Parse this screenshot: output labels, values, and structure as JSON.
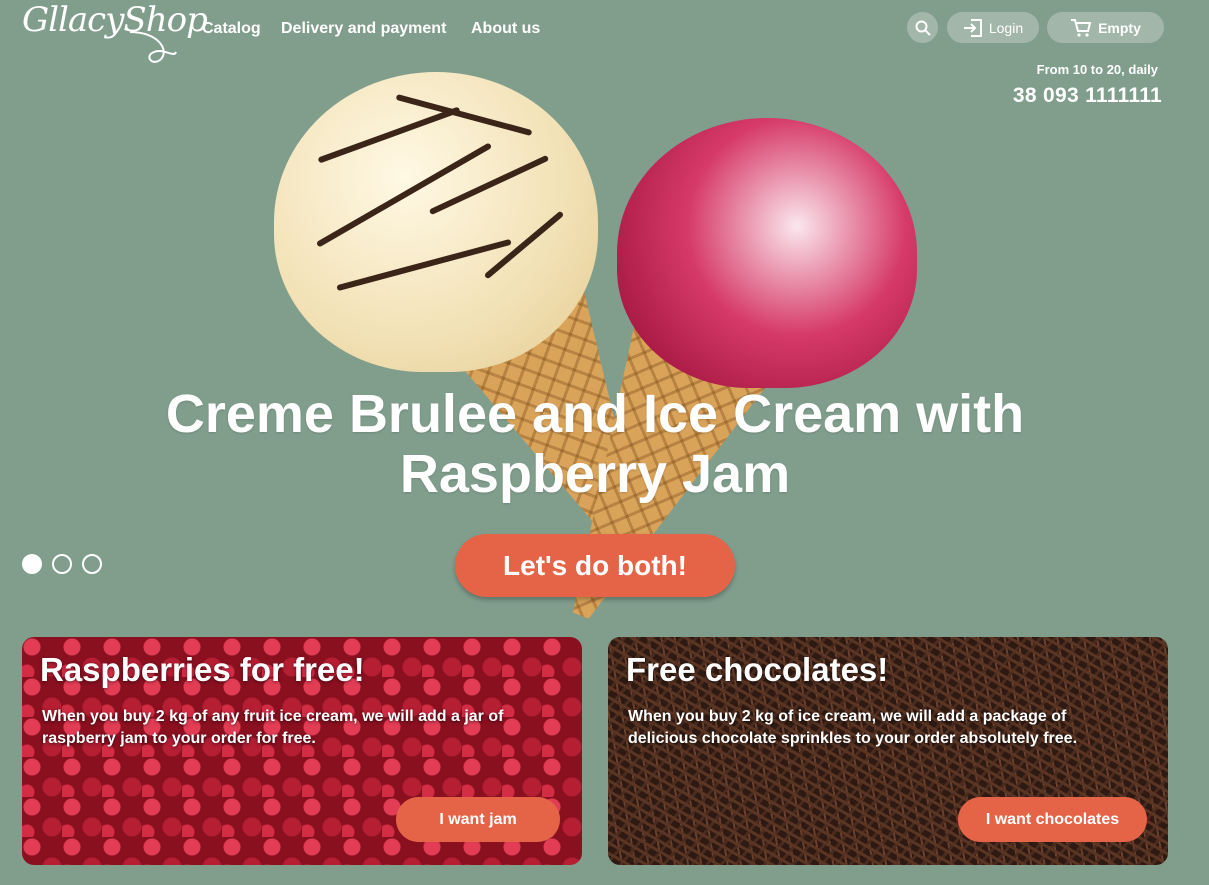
{
  "header": {
    "logo": "GllacyShop",
    "nav": [
      "Catalog",
      "Delivery and payment",
      "About us"
    ],
    "login_label": "Login",
    "cart_label": "Empty",
    "hours": "From 10 to 20, daily",
    "phone": "38 093 1111111",
    "icons": {
      "search": "search-icon",
      "login": "login-icon",
      "cart": "cart-icon"
    }
  },
  "hero": {
    "title": "Creme Brulee and Ice Cream with Raspberry Jam",
    "cta_label": "Let's do both!",
    "slides": 3,
    "active_slide": 1
  },
  "promos": [
    {
      "title": "Raspberries for free!",
      "text": "When you buy 2 kg of any fruit ice cream, we will add a jar of raspberry jam to your order for free.",
      "button": "I want jam"
    },
    {
      "title": "Free chocolates!",
      "text": "When you buy 2 kg of ice cream, we will add a package of delicious chocolate sprinkles to your order absolutely free.",
      "button": "I want chocolates"
    }
  ],
  "colors": {
    "background": "#819e8d",
    "accent": "#e56448"
  }
}
